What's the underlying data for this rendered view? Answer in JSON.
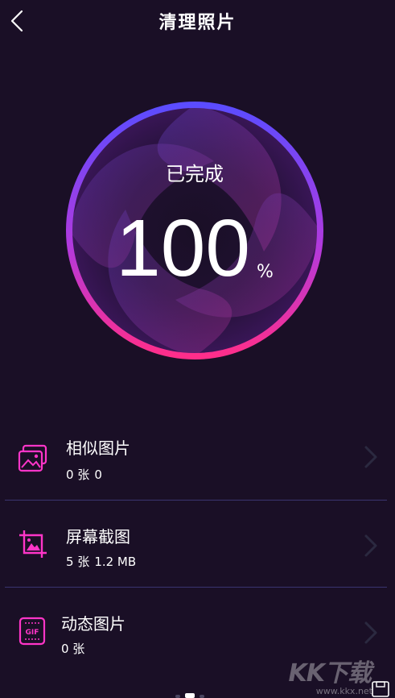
{
  "header": {
    "title": "清理照片",
    "back_icon": "chevron-left-icon"
  },
  "progress": {
    "status": "已完成",
    "value": "100",
    "unit": "%",
    "percent": 100
  },
  "items": [
    {
      "title": "相似图片",
      "count": "0 张",
      "size": "0",
      "icon": "similar-images-icon"
    },
    {
      "title": "屏幕截图",
      "count": "5 张",
      "size": "1.2 MB",
      "icon": "screenshot-icon"
    },
    {
      "title": "动态图片",
      "count": "0 张",
      "size": "",
      "icon": "gif-icon"
    }
  ],
  "watermark": {
    "text": "KK下载",
    "sub": "www.kkx.net"
  },
  "colors": {
    "background": "#1a0f26",
    "ring_top": "#5b4cff",
    "ring_bottom": "#ff2e8a",
    "icon_accent": "#ff35c8",
    "divider": "#3a3470"
  }
}
